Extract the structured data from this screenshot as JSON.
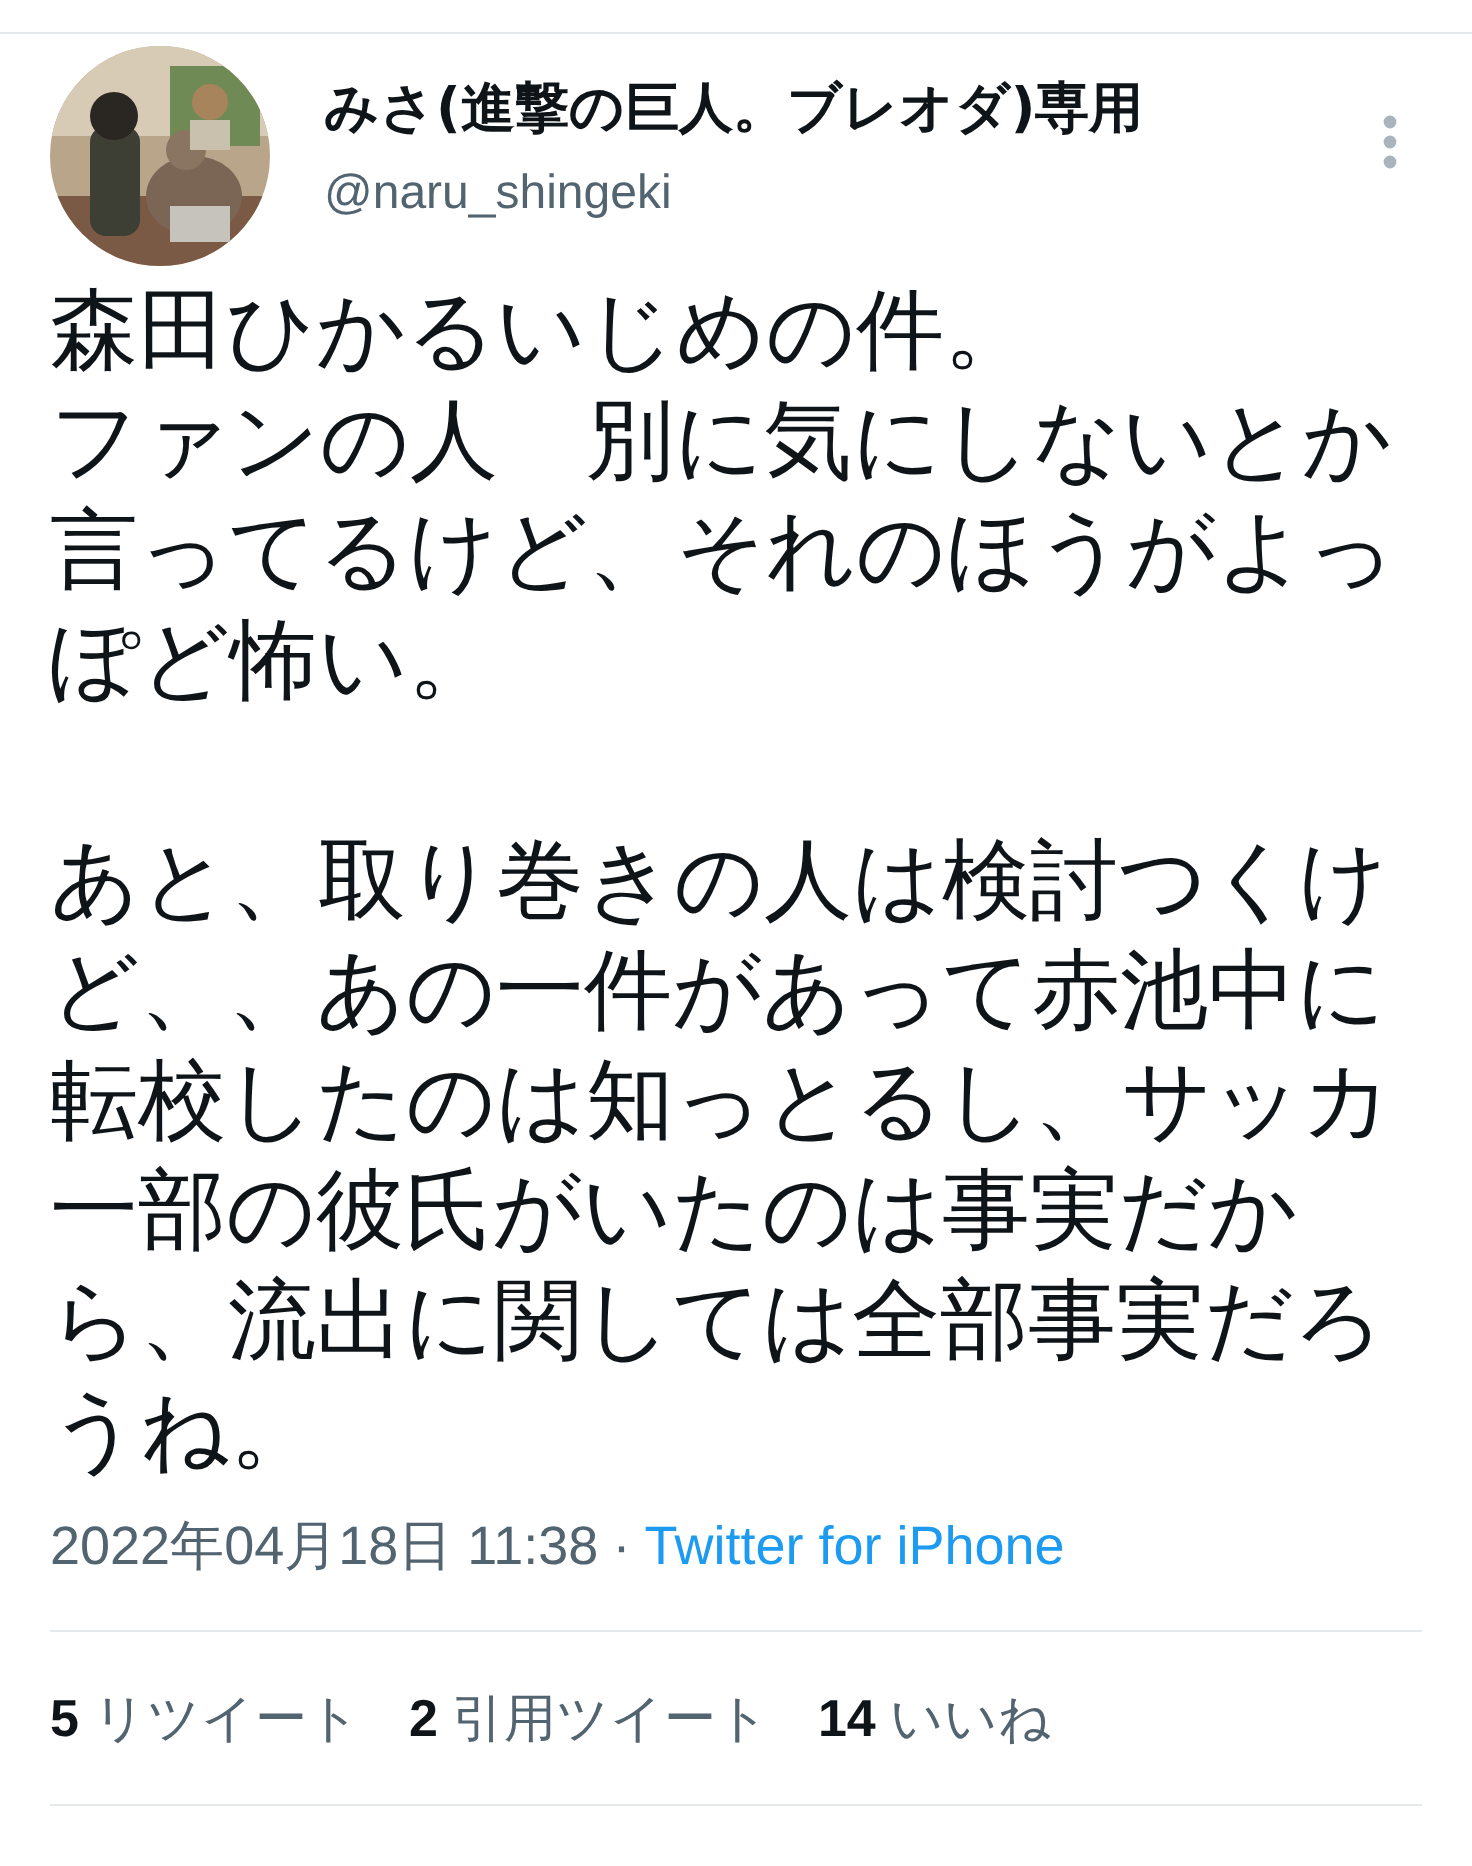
{
  "tweet": {
    "author": {
      "name": "みさ(進撃の巨人。ブレオダ)専用",
      "handle": "@naru_shingeki"
    },
    "paragraphs": [
      [
        "森田ひかるいじめの件。",
        "ファンの人　別に気にしないとか言ってるけど、それのほうがよっぽど怖い。"
      ],
      [
        "あと、取り巻きの人は検討つくけど、、あの一件があって赤池中に転校したのは知っとるし、サッカ一部の彼氏がいたのは事実だから、流出に関しては全部事実だろうね。"
      ]
    ],
    "timestamp": "2022年04月18日 11:38",
    "separator": "·",
    "source": "Twitter for iPhone",
    "stats": [
      {
        "count": "5",
        "label": "リツイート"
      },
      {
        "count": "2",
        "label": "引用ツイート"
      },
      {
        "count": "14",
        "label": "いいね"
      }
    ]
  }
}
